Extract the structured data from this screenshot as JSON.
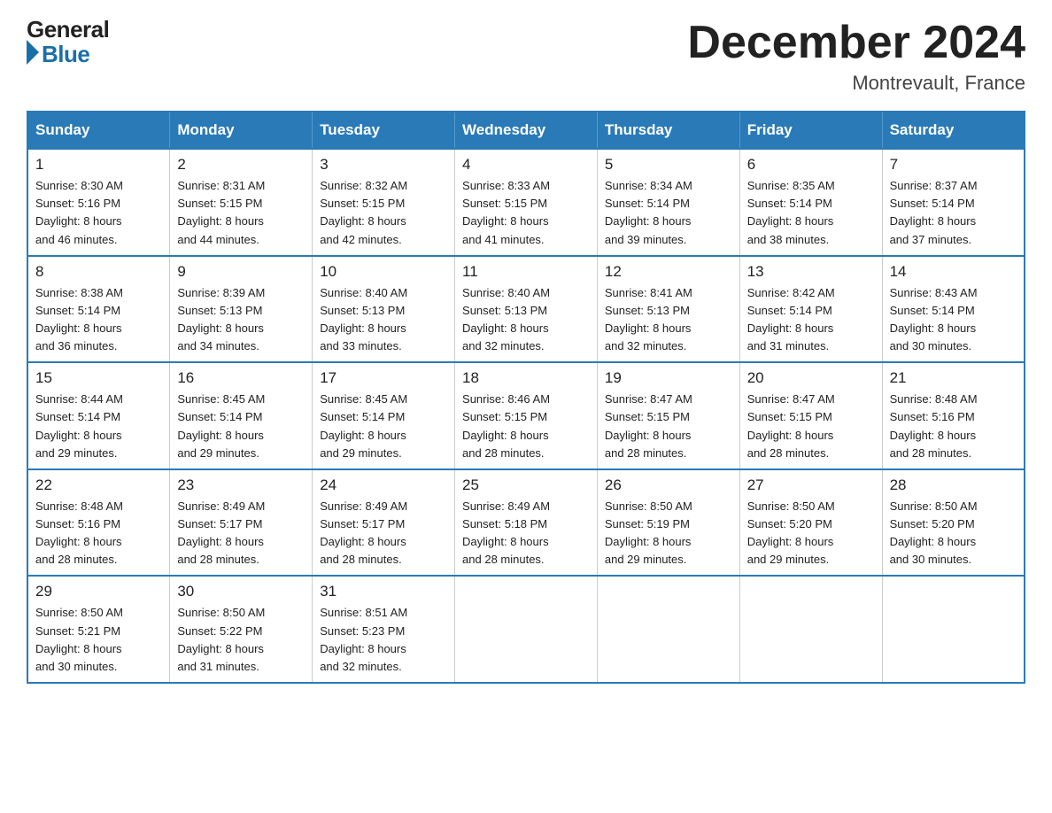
{
  "logo": {
    "general": "General",
    "blue": "Blue"
  },
  "title": "December 2024",
  "subtitle": "Montrevault, France",
  "weekdays": [
    "Sunday",
    "Monday",
    "Tuesday",
    "Wednesday",
    "Thursday",
    "Friday",
    "Saturday"
  ],
  "weeks": [
    [
      {
        "day": "1",
        "sunrise": "8:30 AM",
        "sunset": "5:16 PM",
        "daylight": "8 hours and 46 minutes."
      },
      {
        "day": "2",
        "sunrise": "8:31 AM",
        "sunset": "5:15 PM",
        "daylight": "8 hours and 44 minutes."
      },
      {
        "day": "3",
        "sunrise": "8:32 AM",
        "sunset": "5:15 PM",
        "daylight": "8 hours and 42 minutes."
      },
      {
        "day": "4",
        "sunrise": "8:33 AM",
        "sunset": "5:15 PM",
        "daylight": "8 hours and 41 minutes."
      },
      {
        "day": "5",
        "sunrise": "8:34 AM",
        "sunset": "5:14 PM",
        "daylight": "8 hours and 39 minutes."
      },
      {
        "day": "6",
        "sunrise": "8:35 AM",
        "sunset": "5:14 PM",
        "daylight": "8 hours and 38 minutes."
      },
      {
        "day": "7",
        "sunrise": "8:37 AM",
        "sunset": "5:14 PM",
        "daylight": "8 hours and 37 minutes."
      }
    ],
    [
      {
        "day": "8",
        "sunrise": "8:38 AM",
        "sunset": "5:14 PM",
        "daylight": "8 hours and 36 minutes."
      },
      {
        "day": "9",
        "sunrise": "8:39 AM",
        "sunset": "5:13 PM",
        "daylight": "8 hours and 34 minutes."
      },
      {
        "day": "10",
        "sunrise": "8:40 AM",
        "sunset": "5:13 PM",
        "daylight": "8 hours and 33 minutes."
      },
      {
        "day": "11",
        "sunrise": "8:40 AM",
        "sunset": "5:13 PM",
        "daylight": "8 hours and 32 minutes."
      },
      {
        "day": "12",
        "sunrise": "8:41 AM",
        "sunset": "5:13 PM",
        "daylight": "8 hours and 32 minutes."
      },
      {
        "day": "13",
        "sunrise": "8:42 AM",
        "sunset": "5:14 PM",
        "daylight": "8 hours and 31 minutes."
      },
      {
        "day": "14",
        "sunrise": "8:43 AM",
        "sunset": "5:14 PM",
        "daylight": "8 hours and 30 minutes."
      }
    ],
    [
      {
        "day": "15",
        "sunrise": "8:44 AM",
        "sunset": "5:14 PM",
        "daylight": "8 hours and 29 minutes."
      },
      {
        "day": "16",
        "sunrise": "8:45 AM",
        "sunset": "5:14 PM",
        "daylight": "8 hours and 29 minutes."
      },
      {
        "day": "17",
        "sunrise": "8:45 AM",
        "sunset": "5:14 PM",
        "daylight": "8 hours and 29 minutes."
      },
      {
        "day": "18",
        "sunrise": "8:46 AM",
        "sunset": "5:15 PM",
        "daylight": "8 hours and 28 minutes."
      },
      {
        "day": "19",
        "sunrise": "8:47 AM",
        "sunset": "5:15 PM",
        "daylight": "8 hours and 28 minutes."
      },
      {
        "day": "20",
        "sunrise": "8:47 AM",
        "sunset": "5:15 PM",
        "daylight": "8 hours and 28 minutes."
      },
      {
        "day": "21",
        "sunrise": "8:48 AM",
        "sunset": "5:16 PM",
        "daylight": "8 hours and 28 minutes."
      }
    ],
    [
      {
        "day": "22",
        "sunrise": "8:48 AM",
        "sunset": "5:16 PM",
        "daylight": "8 hours and 28 minutes."
      },
      {
        "day": "23",
        "sunrise": "8:49 AM",
        "sunset": "5:17 PM",
        "daylight": "8 hours and 28 minutes."
      },
      {
        "day": "24",
        "sunrise": "8:49 AM",
        "sunset": "5:17 PM",
        "daylight": "8 hours and 28 minutes."
      },
      {
        "day": "25",
        "sunrise": "8:49 AM",
        "sunset": "5:18 PM",
        "daylight": "8 hours and 28 minutes."
      },
      {
        "day": "26",
        "sunrise": "8:50 AM",
        "sunset": "5:19 PM",
        "daylight": "8 hours and 29 minutes."
      },
      {
        "day": "27",
        "sunrise": "8:50 AM",
        "sunset": "5:20 PM",
        "daylight": "8 hours and 29 minutes."
      },
      {
        "day": "28",
        "sunrise": "8:50 AM",
        "sunset": "5:20 PM",
        "daylight": "8 hours and 30 minutes."
      }
    ],
    [
      {
        "day": "29",
        "sunrise": "8:50 AM",
        "sunset": "5:21 PM",
        "daylight": "8 hours and 30 minutes."
      },
      {
        "day": "30",
        "sunrise": "8:50 AM",
        "sunset": "5:22 PM",
        "daylight": "8 hours and 31 minutes."
      },
      {
        "day": "31",
        "sunrise": "8:51 AM",
        "sunset": "5:23 PM",
        "daylight": "8 hours and 32 minutes."
      },
      null,
      null,
      null,
      null
    ]
  ],
  "labels": {
    "sunrise": "Sunrise:",
    "sunset": "Sunset:",
    "daylight": "Daylight:"
  }
}
